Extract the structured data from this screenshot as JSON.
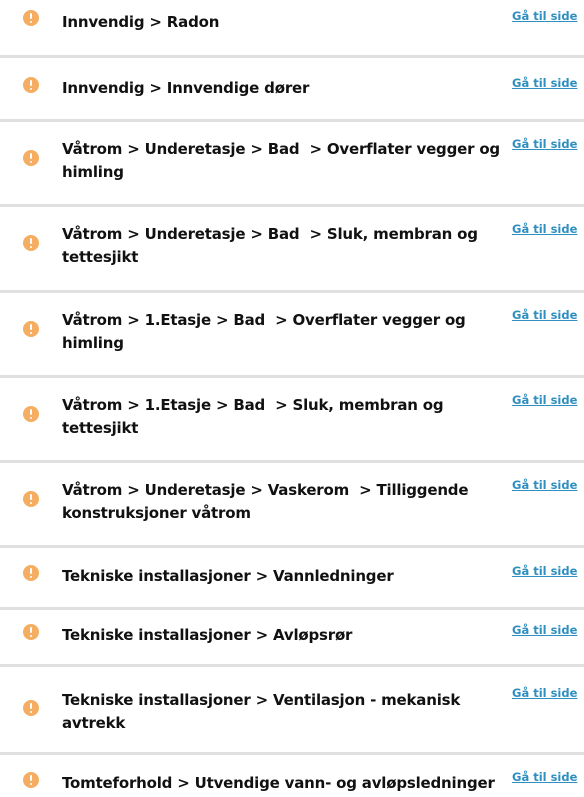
{
  "link_label": "Gå til side",
  "items": [
    {
      "text": "Innvendig > Radon"
    },
    {
      "text": "Innvendig > Innvendige dører"
    },
    {
      "text": "Våtrom > Underetasje > Bad  > Overflater vegger og himling"
    },
    {
      "text": "Våtrom > Underetasje > Bad  > Sluk, membran og tettesjikt"
    },
    {
      "text": "Våtrom > 1.Etasje > Bad  > Overflater vegger og himling"
    },
    {
      "text": "Våtrom > 1.Etasje > Bad  > Sluk, membran og tettesjikt"
    },
    {
      "text": "Våtrom > Underetasje > Vaskerom  > Tilliggende konstruksjoner våtrom"
    },
    {
      "text": "Tekniske installasjoner > Vannledninger"
    },
    {
      "text": "Tekniske installasjoner > Avløpsrør"
    },
    {
      "text": "Tekniske installasjoner > Ventilasjon - mekanisk avtrekk"
    },
    {
      "text": "Tomteforhold > Utvendige vann- og avløpsledninger"
    }
  ],
  "colors": {
    "warning_icon": "#f5ad61",
    "link": "#2f8fc0",
    "divider": "#e0e0e0"
  }
}
